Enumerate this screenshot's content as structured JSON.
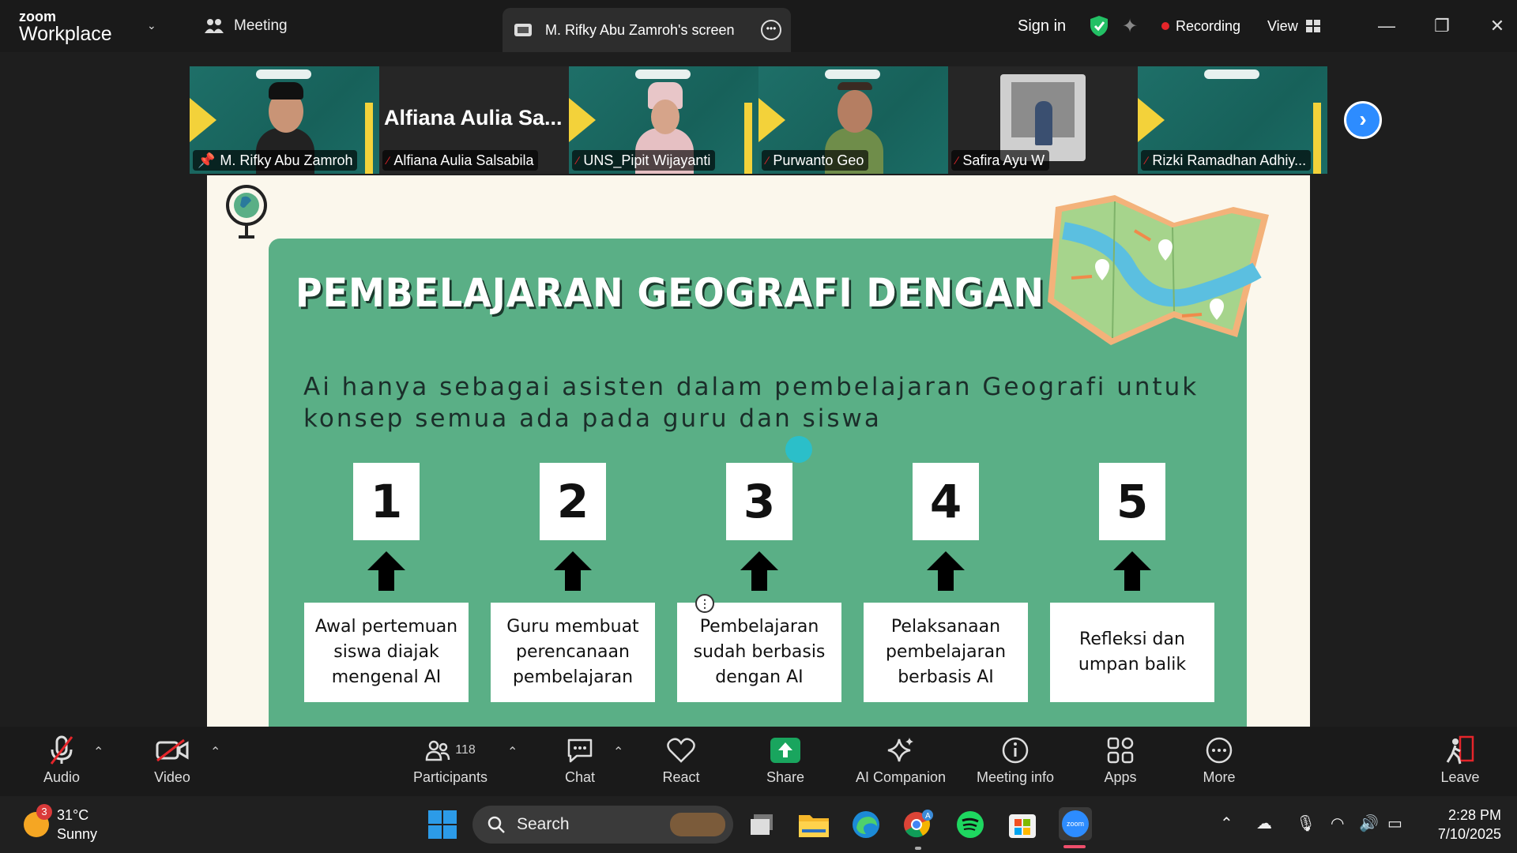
{
  "app": {
    "brand_small": "zoom",
    "brand_big": "Workplace",
    "meeting_tab": "Meeting",
    "screen_tab": "M. Rifky Abu Zamroh's screen"
  },
  "topbar": {
    "sign_in": "Sign in",
    "recording": "Recording",
    "view": "View"
  },
  "participants_strip": [
    {
      "name": "M. Rifky Abu Zamroh",
      "muted": false,
      "pinned": true
    },
    {
      "name": "Alfiana Aulia Salsabila",
      "big_name": "Alfiana Aulia Sa...",
      "muted": true
    },
    {
      "name": "UNS_Pipit Wijayanti",
      "muted": true
    },
    {
      "name": "Purwanto Geo",
      "muted": true
    },
    {
      "name": "Safira Ayu W",
      "muted": true
    },
    {
      "name": "Rizki Ramadhan Adhiy...",
      "muted": true
    }
  ],
  "slide": {
    "title": "PEMBELAJARAN GEOGRAFI DENGAN AI",
    "subtitle_line1": "Ai hanya sebagai asisten dalam pembelajaran Geografi untuk",
    "subtitle_line2": "konsep semua ada pada guru dan siswa",
    "steps": [
      {
        "number": "1",
        "lines": [
          "Awal pertemuan",
          "siswa diajak",
          "mengenal AI"
        ]
      },
      {
        "number": "2",
        "lines": [
          "Guru membuat",
          "perencanaan",
          "pembelajaran"
        ]
      },
      {
        "number": "3",
        "lines": [
          "Pembelajaran",
          "sudah berbasis",
          "dengan AI"
        ]
      },
      {
        "number": "4",
        "lines": [
          "Pelaksanaan",
          "pembelajaran",
          "berbasis AI"
        ]
      },
      {
        "number": "5",
        "lines": [
          "Refleksi dan",
          "umpan balik"
        ]
      }
    ]
  },
  "toolbar": {
    "audio": "Audio",
    "video": "Video",
    "participants": "Participants",
    "participants_count": "118",
    "chat": "Chat",
    "react": "React",
    "share": "Share",
    "ai_companion": "AI Companion",
    "meeting_info": "Meeting info",
    "apps": "Apps",
    "more": "More",
    "leave": "Leave"
  },
  "taskbar": {
    "weather_badge": "3",
    "temperature": "31°C",
    "condition": "Sunny",
    "search": "Search",
    "time": "2:28 PM",
    "date": "7/10/2025"
  },
  "colors": {
    "panel_green": "#5aaf86",
    "slide_bg": "#fbf7ec",
    "active_border": "#33d680",
    "share_green": "#19a55e",
    "recording_red": "#e5252a",
    "zoom_blue": "#2d8cff"
  }
}
